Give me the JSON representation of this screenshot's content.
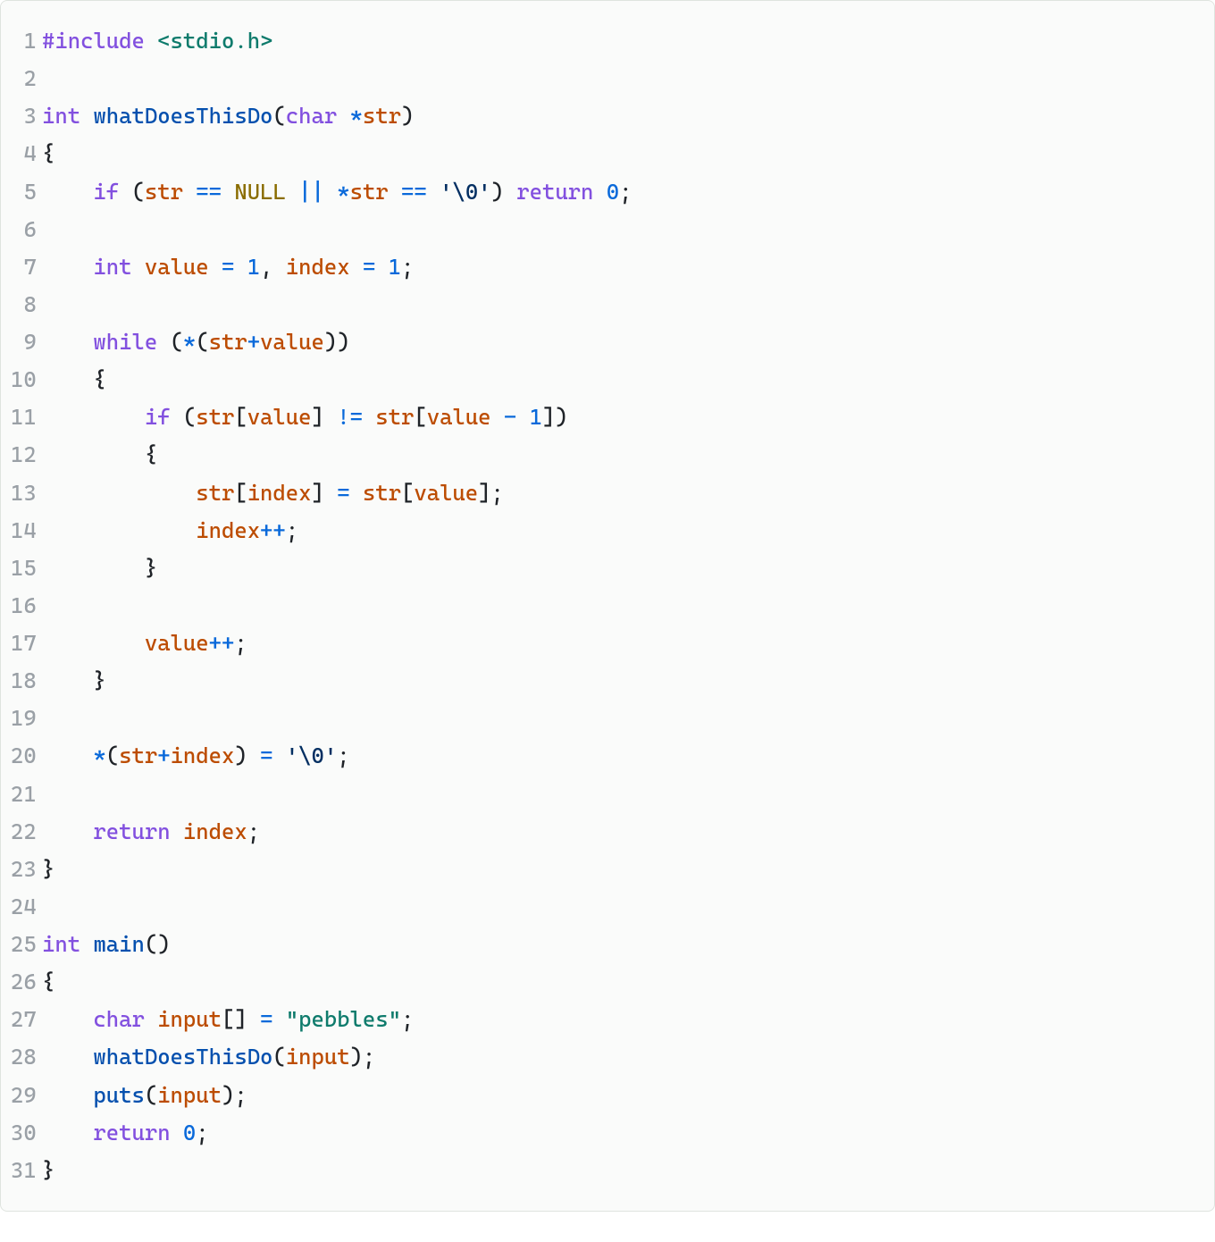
{
  "lines": [
    {
      "num": "1",
      "tokens": [
        {
          "cls": "pp",
          "t": "#include"
        },
        {
          "cls": "pn",
          "t": " "
        },
        {
          "cls": "hdr",
          "t": "<stdio.h>"
        }
      ]
    },
    {
      "num": "2",
      "tokens": []
    },
    {
      "num": "3",
      "tokens": [
        {
          "cls": "kw",
          "t": "int"
        },
        {
          "cls": "pn",
          "t": " "
        },
        {
          "cls": "fn",
          "t": "whatDoesThisDo"
        },
        {
          "cls": "pn",
          "t": "("
        },
        {
          "cls": "kw",
          "t": "char"
        },
        {
          "cls": "pn",
          "t": " "
        },
        {
          "cls": "op",
          "t": "*"
        },
        {
          "cls": "var",
          "t": "str"
        },
        {
          "cls": "pn",
          "t": ")"
        }
      ]
    },
    {
      "num": "4",
      "tokens": [
        {
          "cls": "pn",
          "t": "{"
        }
      ]
    },
    {
      "num": "5",
      "tokens": [
        {
          "cls": "pn",
          "t": "    "
        },
        {
          "cls": "kw",
          "t": "if"
        },
        {
          "cls": "pn",
          "t": " ("
        },
        {
          "cls": "var",
          "t": "str"
        },
        {
          "cls": "pn",
          "t": " "
        },
        {
          "cls": "op",
          "t": "=="
        },
        {
          "cls": "pn",
          "t": " "
        },
        {
          "cls": "null",
          "t": "NULL"
        },
        {
          "cls": "pn",
          "t": " "
        },
        {
          "cls": "op",
          "t": "||"
        },
        {
          "cls": "pn",
          "t": " "
        },
        {
          "cls": "op",
          "t": "*"
        },
        {
          "cls": "var",
          "t": "str"
        },
        {
          "cls": "pn",
          "t": " "
        },
        {
          "cls": "op",
          "t": "=="
        },
        {
          "cls": "pn",
          "t": " "
        },
        {
          "cls": "ch",
          "t": "'\\0'"
        },
        {
          "cls": "pn",
          "t": ") "
        },
        {
          "cls": "kw",
          "t": "return"
        },
        {
          "cls": "pn",
          "t": " "
        },
        {
          "cls": "num",
          "t": "0"
        },
        {
          "cls": "pn",
          "t": ";"
        }
      ]
    },
    {
      "num": "6",
      "tokens": []
    },
    {
      "num": "7",
      "tokens": [
        {
          "cls": "pn",
          "t": "    "
        },
        {
          "cls": "kw",
          "t": "int"
        },
        {
          "cls": "pn",
          "t": " "
        },
        {
          "cls": "var",
          "t": "value"
        },
        {
          "cls": "pn",
          "t": " "
        },
        {
          "cls": "assn",
          "t": "="
        },
        {
          "cls": "pn",
          "t": " "
        },
        {
          "cls": "num",
          "t": "1"
        },
        {
          "cls": "pn",
          "t": ", "
        },
        {
          "cls": "var",
          "t": "index"
        },
        {
          "cls": "pn",
          "t": " "
        },
        {
          "cls": "assn",
          "t": "="
        },
        {
          "cls": "pn",
          "t": " "
        },
        {
          "cls": "num",
          "t": "1"
        },
        {
          "cls": "pn",
          "t": ";"
        }
      ]
    },
    {
      "num": "8",
      "tokens": []
    },
    {
      "num": "9",
      "tokens": [
        {
          "cls": "pn",
          "t": "    "
        },
        {
          "cls": "kw",
          "t": "while"
        },
        {
          "cls": "pn",
          "t": " ("
        },
        {
          "cls": "op",
          "t": "*"
        },
        {
          "cls": "pn",
          "t": "("
        },
        {
          "cls": "var",
          "t": "str"
        },
        {
          "cls": "op",
          "t": "+"
        },
        {
          "cls": "var",
          "t": "value"
        },
        {
          "cls": "pn",
          "t": "))"
        }
      ]
    },
    {
      "num": "10",
      "tokens": [
        {
          "cls": "pn",
          "t": "    {"
        }
      ]
    },
    {
      "num": "11",
      "tokens": [
        {
          "cls": "pn",
          "t": "        "
        },
        {
          "cls": "kw",
          "t": "if"
        },
        {
          "cls": "pn",
          "t": " ("
        },
        {
          "cls": "var",
          "t": "str"
        },
        {
          "cls": "pn",
          "t": "["
        },
        {
          "cls": "var",
          "t": "value"
        },
        {
          "cls": "pn",
          "t": "] "
        },
        {
          "cls": "op",
          "t": "!="
        },
        {
          "cls": "pn",
          "t": " "
        },
        {
          "cls": "var",
          "t": "str"
        },
        {
          "cls": "pn",
          "t": "["
        },
        {
          "cls": "var",
          "t": "value"
        },
        {
          "cls": "pn",
          "t": " "
        },
        {
          "cls": "op",
          "t": "-"
        },
        {
          "cls": "pn",
          "t": " "
        },
        {
          "cls": "num",
          "t": "1"
        },
        {
          "cls": "pn",
          "t": "])"
        }
      ]
    },
    {
      "num": "12",
      "tokens": [
        {
          "cls": "pn",
          "t": "        {"
        }
      ]
    },
    {
      "num": "13",
      "tokens": [
        {
          "cls": "pn",
          "t": "            "
        },
        {
          "cls": "var",
          "t": "str"
        },
        {
          "cls": "pn",
          "t": "["
        },
        {
          "cls": "var",
          "t": "index"
        },
        {
          "cls": "pn",
          "t": "] "
        },
        {
          "cls": "assn",
          "t": "="
        },
        {
          "cls": "pn",
          "t": " "
        },
        {
          "cls": "var",
          "t": "str"
        },
        {
          "cls": "pn",
          "t": "["
        },
        {
          "cls": "var",
          "t": "value"
        },
        {
          "cls": "pn",
          "t": "];"
        }
      ]
    },
    {
      "num": "14",
      "tokens": [
        {
          "cls": "pn",
          "t": "            "
        },
        {
          "cls": "var",
          "t": "index"
        },
        {
          "cls": "op",
          "t": "++"
        },
        {
          "cls": "pn",
          "t": ";"
        }
      ]
    },
    {
      "num": "15",
      "tokens": [
        {
          "cls": "pn",
          "t": "        }"
        }
      ]
    },
    {
      "num": "16",
      "tokens": []
    },
    {
      "num": "17",
      "tokens": [
        {
          "cls": "pn",
          "t": "        "
        },
        {
          "cls": "var",
          "t": "value"
        },
        {
          "cls": "op",
          "t": "++"
        },
        {
          "cls": "pn",
          "t": ";"
        }
      ]
    },
    {
      "num": "18",
      "tokens": [
        {
          "cls": "pn",
          "t": "    }"
        }
      ]
    },
    {
      "num": "19",
      "tokens": []
    },
    {
      "num": "20",
      "tokens": [
        {
          "cls": "pn",
          "t": "    "
        },
        {
          "cls": "op",
          "t": "*"
        },
        {
          "cls": "pn",
          "t": "("
        },
        {
          "cls": "var",
          "t": "str"
        },
        {
          "cls": "op",
          "t": "+"
        },
        {
          "cls": "var",
          "t": "index"
        },
        {
          "cls": "pn",
          "t": ") "
        },
        {
          "cls": "assn",
          "t": "="
        },
        {
          "cls": "pn",
          "t": " "
        },
        {
          "cls": "ch",
          "t": "'\\0'"
        },
        {
          "cls": "pn",
          "t": ";"
        }
      ]
    },
    {
      "num": "21",
      "tokens": []
    },
    {
      "num": "22",
      "tokens": [
        {
          "cls": "pn",
          "t": "    "
        },
        {
          "cls": "kw",
          "t": "return"
        },
        {
          "cls": "pn",
          "t": " "
        },
        {
          "cls": "var",
          "t": "index"
        },
        {
          "cls": "pn",
          "t": ";"
        }
      ]
    },
    {
      "num": "23",
      "tokens": [
        {
          "cls": "pn",
          "t": "}"
        }
      ]
    },
    {
      "num": "24",
      "tokens": []
    },
    {
      "num": "25",
      "tokens": [
        {
          "cls": "kw",
          "t": "int"
        },
        {
          "cls": "pn",
          "t": " "
        },
        {
          "cls": "fn",
          "t": "main"
        },
        {
          "cls": "pn",
          "t": "()"
        }
      ]
    },
    {
      "num": "26",
      "tokens": [
        {
          "cls": "pn",
          "t": "{"
        }
      ]
    },
    {
      "num": "27",
      "tokens": [
        {
          "cls": "pn",
          "t": "    "
        },
        {
          "cls": "kw",
          "t": "char"
        },
        {
          "cls": "pn",
          "t": " "
        },
        {
          "cls": "var",
          "t": "input"
        },
        {
          "cls": "pn",
          "t": "[] "
        },
        {
          "cls": "assn",
          "t": "="
        },
        {
          "cls": "pn",
          "t": " "
        },
        {
          "cls": "str",
          "t": "\"pebbles\""
        },
        {
          "cls": "pn",
          "t": ";"
        }
      ]
    },
    {
      "num": "28",
      "tokens": [
        {
          "cls": "pn",
          "t": "    "
        },
        {
          "cls": "fn",
          "t": "whatDoesThisDo"
        },
        {
          "cls": "pn",
          "t": "("
        },
        {
          "cls": "var",
          "t": "input"
        },
        {
          "cls": "pn",
          "t": ");"
        }
      ]
    },
    {
      "num": "29",
      "tokens": [
        {
          "cls": "pn",
          "t": "    "
        },
        {
          "cls": "fn",
          "t": "puts"
        },
        {
          "cls": "pn",
          "t": "("
        },
        {
          "cls": "var",
          "t": "input"
        },
        {
          "cls": "pn",
          "t": ");"
        }
      ]
    },
    {
      "num": "30",
      "tokens": [
        {
          "cls": "pn",
          "t": "    "
        },
        {
          "cls": "kw",
          "t": "return"
        },
        {
          "cls": "pn",
          "t": " "
        },
        {
          "cls": "num",
          "t": "0"
        },
        {
          "cls": "pn",
          "t": ";"
        }
      ]
    },
    {
      "num": "31",
      "tokens": [
        {
          "cls": "pn",
          "t": "}"
        }
      ]
    }
  ]
}
